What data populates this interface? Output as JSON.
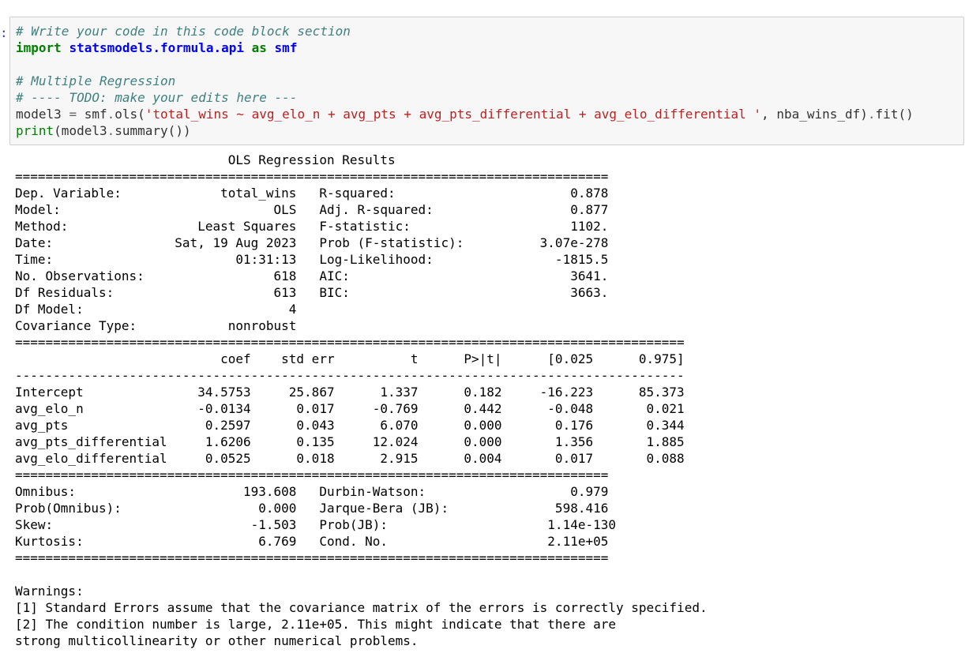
{
  "cell": {
    "prompt": ":",
    "code_lines": [
      [
        {
          "t": "# Write your code in this code block section",
          "c": "comment"
        }
      ],
      [
        {
          "t": "import",
          "c": "kw"
        },
        {
          "t": " ",
          "c": "plain"
        },
        {
          "t": "statsmodels.formula.api",
          "c": "mod"
        },
        {
          "t": " ",
          "c": "plain"
        },
        {
          "t": "as",
          "c": "kw"
        },
        {
          "t": " ",
          "c": "plain"
        },
        {
          "t": "smf",
          "c": "mod"
        }
      ],
      [
        {
          "t": "",
          "c": "plain"
        }
      ],
      [
        {
          "t": "# Multiple Regression",
          "c": "comment"
        }
      ],
      [
        {
          "t": "# ---- TODO: make your edits here ---",
          "c": "comment"
        }
      ],
      [
        {
          "t": "model3 ",
          "c": "plain"
        },
        {
          "t": "=",
          "c": "op"
        },
        {
          "t": " smf",
          "c": "plain"
        },
        {
          "t": ".",
          "c": "op"
        },
        {
          "t": "ols(",
          "c": "plain"
        },
        {
          "t": "'total_wins ~ avg_elo_n + avg_pts + avg_pts_differential + avg_elo_differential '",
          "c": "str"
        },
        {
          "t": ", nba_wins_df)",
          "c": "plain"
        },
        {
          "t": ".",
          "c": "op"
        },
        {
          "t": "fit()",
          "c": "plain"
        }
      ],
      [
        {
          "t": "print",
          "c": "builtin"
        },
        {
          "t": "(model3",
          "c": "plain"
        },
        {
          "t": ".",
          "c": "op"
        },
        {
          "t": "summary())",
          "c": "plain"
        }
      ]
    ]
  },
  "output_lines": [
    "                            OLS Regression Results                            ",
    "==============================================================================",
    "Dep. Variable:             total_wins   R-squared:                       0.878",
    "Model:                            OLS   Adj. R-squared:                  0.877",
    "Method:                 Least Squares   F-statistic:                     1102.",
    "Date:                Sat, 19 Aug 2023   Prob (F-statistic):          3.07e-278",
    "Time:                        01:31:13   Log-Likelihood:                -1815.5",
    "No. Observations:                 618   AIC:                             3641.",
    "Df Residuals:                     613   BIC:                             3663.",
    "Df Model:                           4                                         ",
    "Covariance Type:            nonrobust                                         ",
    "========================================================================================",
    "                           coef    std err          t      P>|t|      [0.025      0.975]",
    "----------------------------------------------------------------------------------------",
    "Intercept               34.5753     25.867      1.337      0.182     -16.223      85.373",
    "avg_elo_n               -0.0134      0.017     -0.769      0.442      -0.048       0.021",
    "avg_pts                  0.2597      0.043      6.070      0.000       0.176       0.344",
    "avg_pts_differential     1.6206      0.135     12.024      0.000       1.356       1.885",
    "avg_elo_differential     0.0525      0.018      2.915      0.004       0.017       0.088",
    "==============================================================================",
    "Omnibus:                      193.608   Durbin-Watson:                   0.979",
    "Prob(Omnibus):                  0.000   Jarque-Bera (JB):              598.416",
    "Skew:                          -1.503   Prob(JB):                     1.14e-130",
    "Kurtosis:                       6.769   Cond. No.                     2.11e+05",
    "==============================================================================",
    "",
    "Warnings:",
    "[1] Standard Errors assume that the covariance matrix of the errors is correctly specified.",
    "[2] The condition number is large, 2.11e+05. This might indicate that there are",
    "strong multicollinearity or other numerical problems."
  ]
}
